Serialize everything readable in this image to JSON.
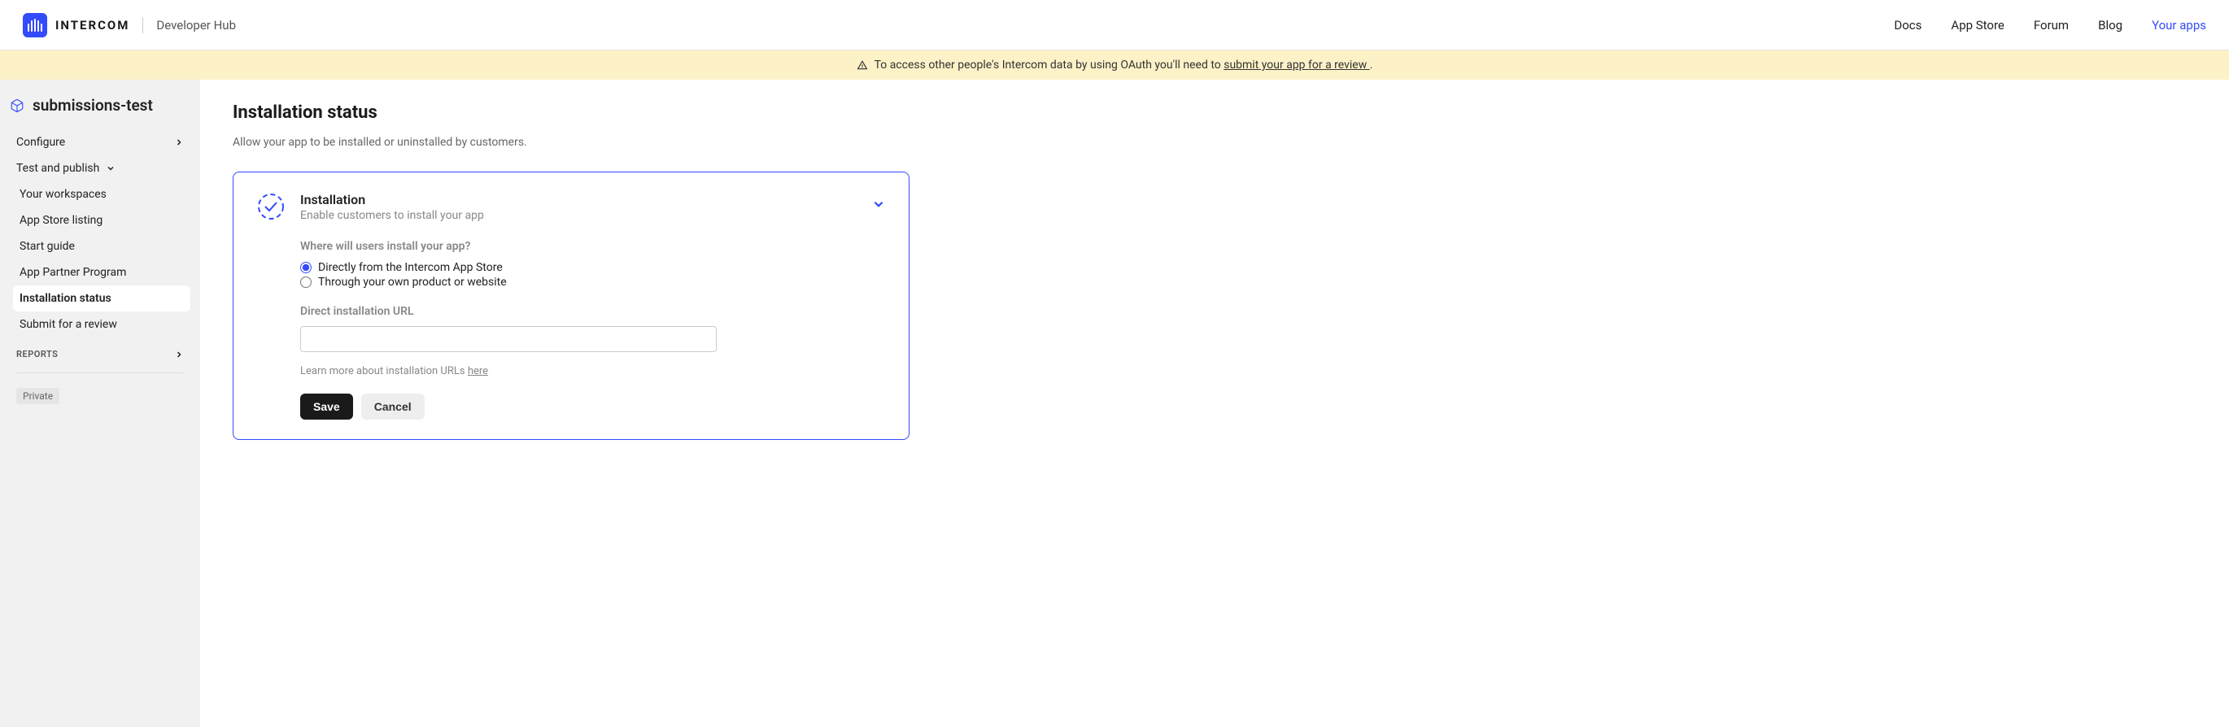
{
  "header": {
    "brand": "INTERCOM",
    "dev_hub": "Developer Hub",
    "nav": {
      "docs": "Docs",
      "app_store": "App Store",
      "forum": "Forum",
      "blog": "Blog",
      "your_apps": "Your apps"
    }
  },
  "banner": {
    "text_before": "To access other people's Intercom data by using OAuth you'll need to ",
    "link": "submit your app for a review ",
    "text_after": "."
  },
  "sidebar": {
    "app_name": "submissions-test",
    "configure": "Configure",
    "test_publish": "Test and publish",
    "items": {
      "workspaces": "Your workspaces",
      "listing": "App Store listing",
      "start_guide": "Start guide",
      "partner": "App Partner Program",
      "install_status": "Installation status",
      "submit_review": "Submit for a review"
    },
    "reports_label": "REPORTS",
    "private_badge": "Private"
  },
  "main": {
    "title": "Installation status",
    "subtitle": "Allow your app to be installed or uninstalled by customers."
  },
  "card": {
    "title": "Installation",
    "desc": "Enable customers to install your app",
    "question": "Where will users install your app?",
    "radio1": "Directly from the Intercom App Store",
    "radio2": "Through your own product or website",
    "url_label": "Direct installation URL",
    "url_value": "",
    "help_before": "Learn more about installation URLs ",
    "help_link": "here",
    "save": "Save",
    "cancel": "Cancel"
  }
}
